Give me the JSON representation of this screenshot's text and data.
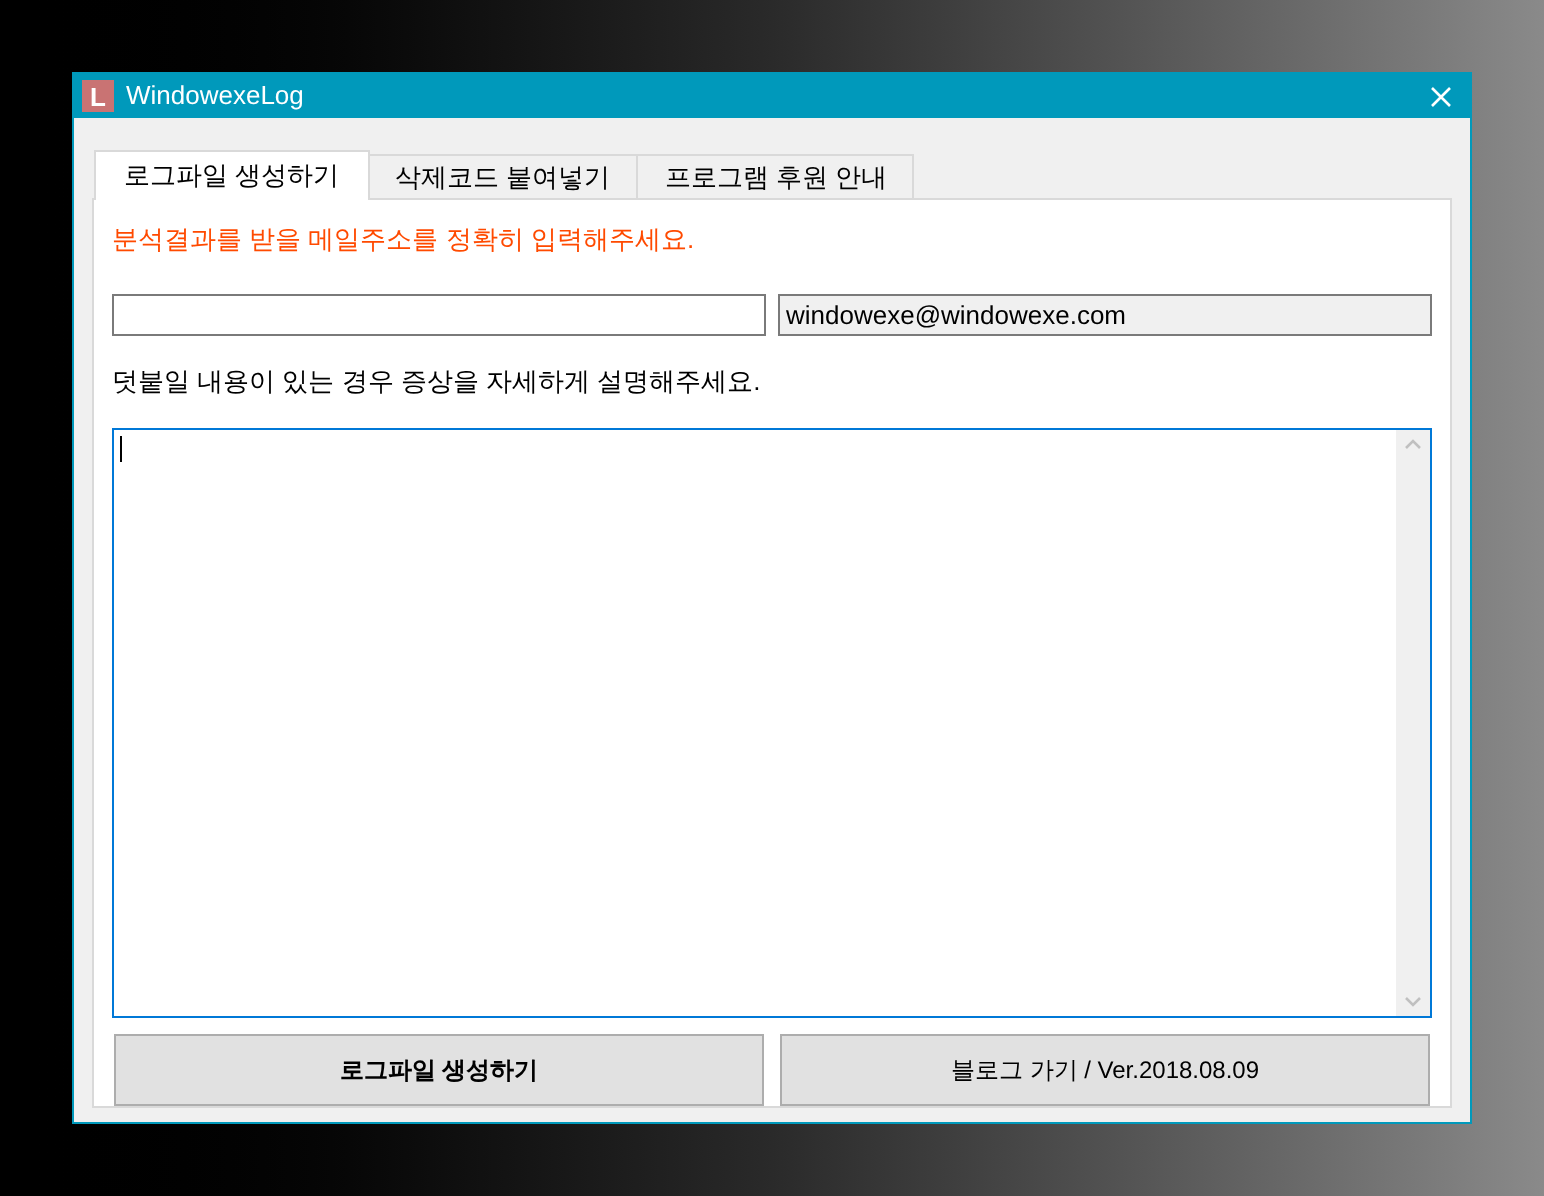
{
  "window": {
    "icon_letter": "L",
    "title": "WindowexeLog"
  },
  "tabs": [
    {
      "label": "로그파일 생성하기",
      "selected": true
    },
    {
      "label": "삭제코드 붙여넣기",
      "selected": false
    },
    {
      "label": "프로그램 후원 안내",
      "selected": false
    }
  ],
  "notice": "분석결과를 받을 메일주소를 정확히 입력해주세요.",
  "sender_field": {
    "value": "windowexe@windowexe.com"
  },
  "description_label": "덧붙일 내용이 있는 경우 증상을 자세하게 설명해주세요.",
  "buttons": [
    {
      "label": "로그파일 생성하기",
      "bold": true
    },
    {
      "label": "블로그 가기 / Ver.2018.08.09",
      "bold": false
    }
  ]
}
